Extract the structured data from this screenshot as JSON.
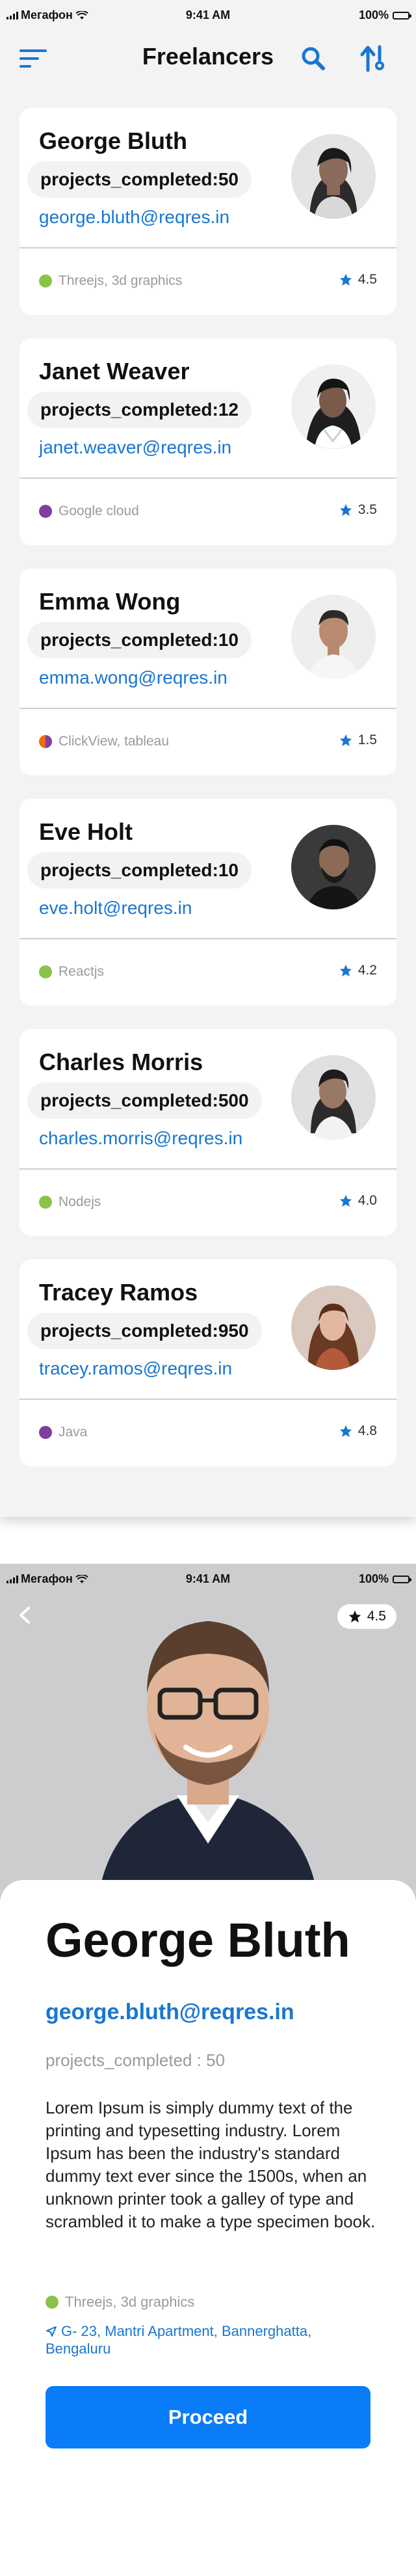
{
  "status_bar": {
    "carrier": "Мегафон",
    "time": "9:41 AM",
    "battery": "100%"
  },
  "list_screen": {
    "title": "Freelancers",
    "freelancers": [
      {
        "name": "George Bluth",
        "projects": "projects_completed:50",
        "email": "george.bluth@reqres.in",
        "skills": "Threejs, 3d graphics",
        "rating": "4.5",
        "dot_color": "#8bc34a"
      },
      {
        "name": "Janet Weaver",
        "projects": "projects_completed:12",
        "email": "janet.weaver@reqres.in",
        "skills": "Google cloud",
        "rating": "3.5",
        "dot_color": "#7e3fa0"
      },
      {
        "name": "Emma Wong",
        "projects": "projects_completed:10",
        "email": "emma.wong@reqres.in",
        "skills": "ClickView, tableau",
        "rating": "1.5",
        "dot_color": "#ef6c00"
      },
      {
        "name": "Eve Holt",
        "projects": "projects_completed:10",
        "email": "eve.holt@reqres.in",
        "skills": "Reactjs",
        "rating": "4.2",
        "dot_color": "#8bc34a"
      },
      {
        "name": "Charles Morris",
        "projects": "projects_completed:500",
        "email": "charles.morris@reqres.in",
        "skills": "Nodejs",
        "rating": "4.0",
        "dot_color": "#8bc34a"
      },
      {
        "name": "Tracey Ramos",
        "projects": "projects_completed:950",
        "email": "tracey.ramos@reqres.in",
        "skills": "Java",
        "rating": "4.8",
        "dot_color": "#7e3fa0"
      }
    ]
  },
  "detail_screen": {
    "rating": "4.5",
    "name": "George Bluth",
    "email": "george.bluth@reqres.in",
    "projects": "projects_completed : 50",
    "description": "Lorem Ipsum is simply dummy text of the printing and typesetting industry. Lorem Ipsum has been the industry's standard dummy text ever since the 1500s, when an unknown printer took a galley of type and scrambled it to make a type specimen book.",
    "skills": "Threejs, 3d graphics",
    "skills_dot_color": "#8bc34a",
    "address": "G- 23, Mantri Apartment, Bannerghatta, Bengaluru",
    "proceed_label": "Proceed"
  },
  "colors": {
    "accent": "#1976d2",
    "button": "#0a7cf8",
    "star": "#1976d2"
  }
}
